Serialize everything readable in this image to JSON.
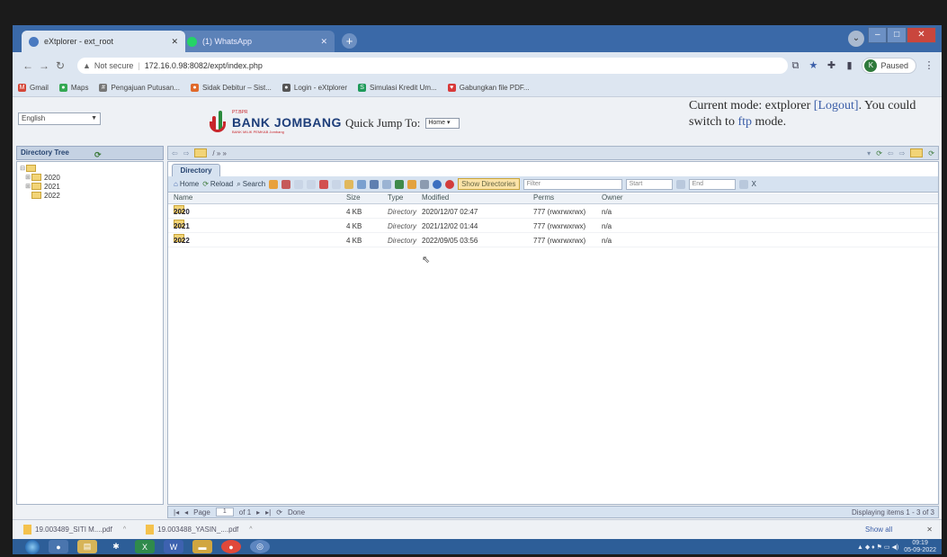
{
  "browser": {
    "tabs": [
      {
        "label": "eXtplorer - ext_root",
        "close": "✕"
      },
      {
        "label": "(1) WhatsApp",
        "close": "✕"
      }
    ],
    "new_tab": "+",
    "security": "Not secure",
    "url": "172.16.0.98:8082/expt/index.php",
    "profile_initial": "K",
    "profile_status": "Paused",
    "bookmarks": [
      {
        "label": "Gmail",
        "color": "#d44638"
      },
      {
        "label": "Maps",
        "color": "#34a853"
      },
      {
        "label": "Pengajuan Putusan...",
        "color": "#777777"
      },
      {
        "label": "Sidak Debitur – Sist...",
        "color": "#e0692b"
      },
      {
        "label": "Login - eXtplorer",
        "color": "#555555"
      },
      {
        "label": "Simulasi Kredit Um...",
        "color": "#1e9a5a"
      },
      {
        "label": "Gabungkan file PDF...",
        "color": "#d83a3a"
      }
    ]
  },
  "header": {
    "language": "English",
    "logo_small": "PT.BPR",
    "logo_name": "BANK JOMBANG",
    "logo_tag": "BANK MILIK PEMKAB Jombang",
    "quick_jump_label": "Quick Jump To:",
    "quick_jump_value": "Home",
    "mode_text_1": "Current mode: extplorer ",
    "logout": "[Logout]",
    "mode_text_2": ". You could switch to ",
    "ftp": "ftp",
    "mode_text_3": " mode."
  },
  "tree": {
    "title": "Directory Tree",
    "nodes": [
      "2020",
      "2021",
      "2022"
    ]
  },
  "navrow": {
    "path": "/ » »"
  },
  "panel": {
    "tab": "Directory",
    "toolbar": {
      "home": "Home",
      "reload": "Reload",
      "search": "Search",
      "show_directories": "Show Directories",
      "filter": "Filter",
      "start": "Start",
      "end": "End",
      "clear": "X"
    },
    "columns": {
      "name": "Name",
      "size": "Size",
      "type": "Type",
      "modified": "Modified",
      "perms": "Perms",
      "owner": "Owner"
    },
    "rows": [
      {
        "name": "2020",
        "size": "4 KB",
        "type": "Directory",
        "modified": "2020/12/07 02:47",
        "perms": "777 (rwxrwxrwx)",
        "owner": "n/a"
      },
      {
        "name": "2021",
        "size": "4 KB",
        "type": "Directory",
        "modified": "2021/12/02 01:44",
        "perms": "777 (rwxrwxrwx)",
        "owner": "n/a"
      },
      {
        "name": "2022",
        "size": "4 KB",
        "type": "Directory",
        "modified": "2022/09/05 03:56",
        "perms": "777 (rwxrwxrwx)",
        "owner": "n/a"
      }
    ]
  },
  "pager": {
    "page_label": "Page",
    "page_value": "1",
    "of": "of 1",
    "status": "Done",
    "displaying": "Displaying items 1 - 3 of 3"
  },
  "downloads": {
    "items": [
      "19.003489_SITI M....pdf",
      "19.003488_YASIN_....pdf"
    ],
    "show_all": "Show all",
    "close": "✕"
  },
  "taskbar": {
    "time": "09:19",
    "date": "05-09-2022"
  }
}
